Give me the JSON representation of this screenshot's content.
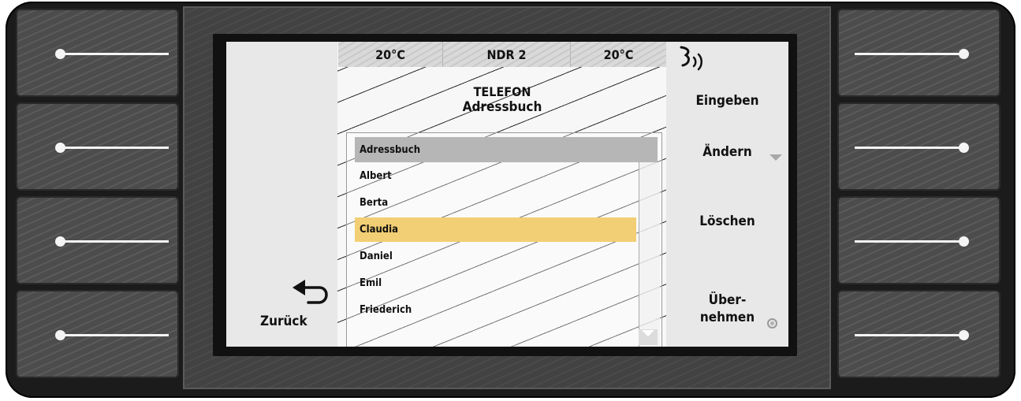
{
  "status": {
    "temp_left": "20°C",
    "station": "NDR 2",
    "temp_right": "20°C"
  },
  "header": {
    "title": "TELEFON",
    "subtitle": "Adressbuch"
  },
  "list": {
    "header": "Adressbuch",
    "items": [
      "Albert",
      "Berta",
      "Claudia",
      "Daniel",
      "Emil",
      "Friederich"
    ],
    "selected": "Claudia"
  },
  "softkeys": {
    "eingeben": "Eingeben",
    "aendern": "Ändern",
    "loeschen": "Löschen",
    "uebernehmen_line1": "Über-",
    "uebernehmen_line2": "nehmen",
    "zurueck": "Zurück"
  },
  "colors": {
    "selection": "#f2cf74",
    "list_header": "#b6b6b6",
    "bezel": "#1b1b1b"
  },
  "icons": {
    "voice": "voice-icon",
    "back": "back-arrow-icon",
    "down": "chevron-down-icon",
    "scroll_down": "scroll-down-icon",
    "radio": "radio-icon"
  }
}
